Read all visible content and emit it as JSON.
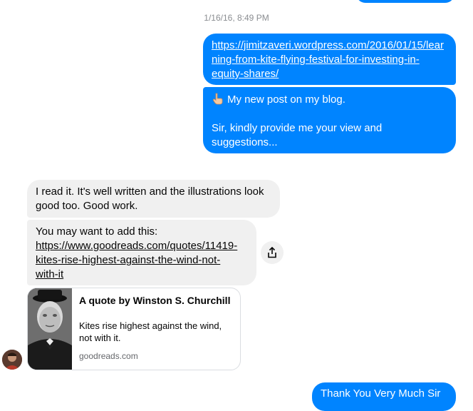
{
  "timestamp": "1/16/16, 8:49 PM",
  "messages": {
    "link_post": {
      "lines": [
        "https://jimitzaveri.wordpress.com/2016/01/15/lear",
        "ning-from-kite-flying-festival-for-investing-in-",
        "equity-shares/"
      ]
    },
    "new_post": {
      "emoji": "pointing-hand-icon",
      "line1": "My new post on my blog.",
      "line2": "Sir, kindly provide me your view and",
      "line3": "suggestions..."
    },
    "reply_read": {
      "line1": "I read it. It's well written and the illustrations look",
      "line2": "good too. Good work."
    },
    "reply_add": {
      "intro": "You may want to add this:",
      "link_lines": [
        "https://www.goodreads.com/quotes/11419-",
        "kites-rise-highest-against-the-wind-not-",
        "with-it"
      ]
    },
    "last_out": {
      "text": "Thank You Very Much Sir"
    }
  },
  "preview_card": {
    "title": "A quote by Winston S. Churchill",
    "description": "Kites rise highest against the wind, not with it.",
    "domain": "goodreads.com"
  },
  "icons": {
    "share": "share-icon",
    "avatar": "contact-avatar"
  },
  "colors": {
    "outgoing": "#0084ff",
    "incoming": "#f0f0f0",
    "timestamp": "#8a8d91"
  }
}
